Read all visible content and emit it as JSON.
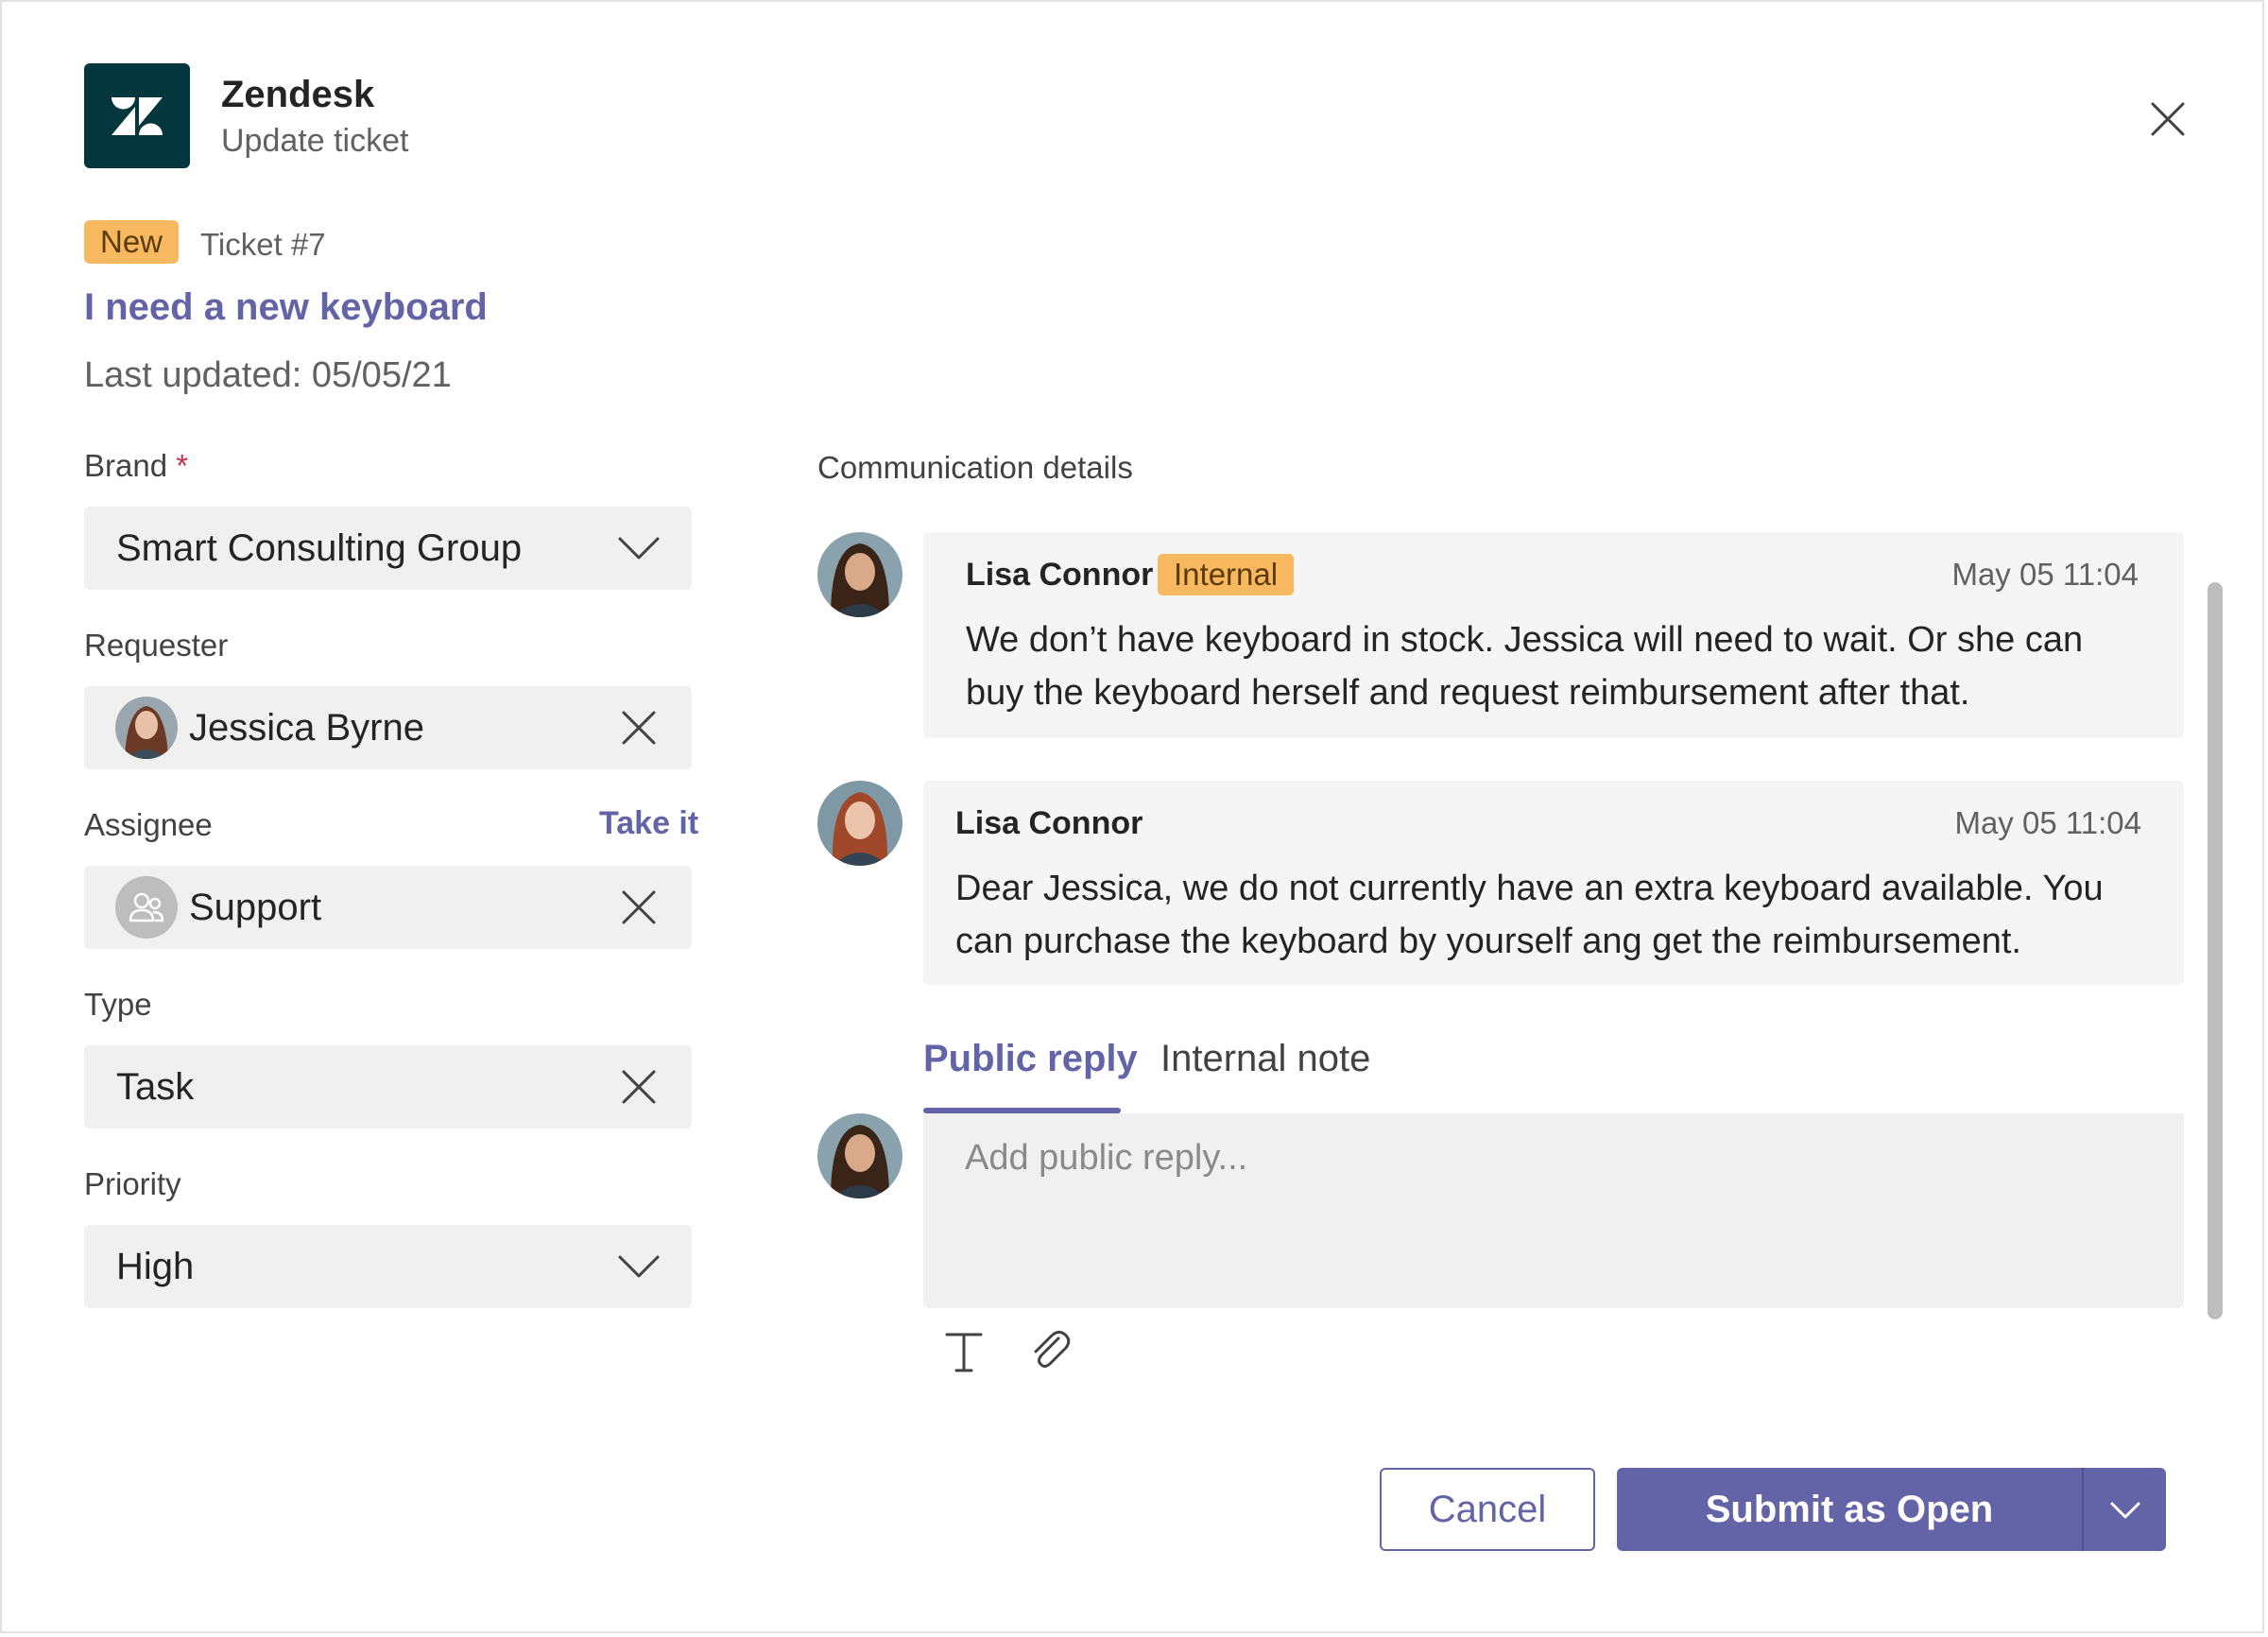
{
  "header": {
    "app_name": "Zendesk",
    "subtitle": "Update ticket",
    "logo_icon": "zendesk-logo",
    "close_icon": "close-icon"
  },
  "ticket": {
    "status": "New",
    "number": "Ticket #7",
    "title": "I need a new keyboard",
    "last_updated": "Last updated: 05/05/21"
  },
  "form": {
    "brand": {
      "label": "Brand",
      "required_mark": "*",
      "value": "Smart Consulting Group"
    },
    "requester": {
      "label": "Requester",
      "value": "Jessica Byrne"
    },
    "assignee": {
      "label": "Assignee",
      "action": "Take it",
      "value": "Support"
    },
    "type": {
      "label": "Type",
      "value": "Task"
    },
    "priority": {
      "label": "Priority",
      "value": "High"
    }
  },
  "communication": {
    "label": "Communication details",
    "messages": [
      {
        "author": "Lisa Connor",
        "badge": "Internal",
        "time": "May 05 11:04",
        "text": "We don’t have keyboard in stock. Jessica will need to wait. Or she can buy the keyboard herself and request reimbursement after that."
      },
      {
        "author": "Lisa Connor",
        "badge": "",
        "time": "May 05 11:04",
        "text": "Dear Jessica, we do not currently have an extra keyboard available. You can purchase the keyboard by yourself ang get the reimbursement."
      }
    ],
    "tabs": [
      "Public reply",
      "Internal note"
    ],
    "reply_placeholder": "Add public reply...",
    "tools": [
      "text-format-icon",
      "attach-icon"
    ]
  },
  "actions": {
    "cancel": "Cancel",
    "submit": "Submit as Open"
  },
  "colors": {
    "accent": "#6264a7",
    "badge": "#f8b860",
    "logo_bg": "#03363d"
  }
}
